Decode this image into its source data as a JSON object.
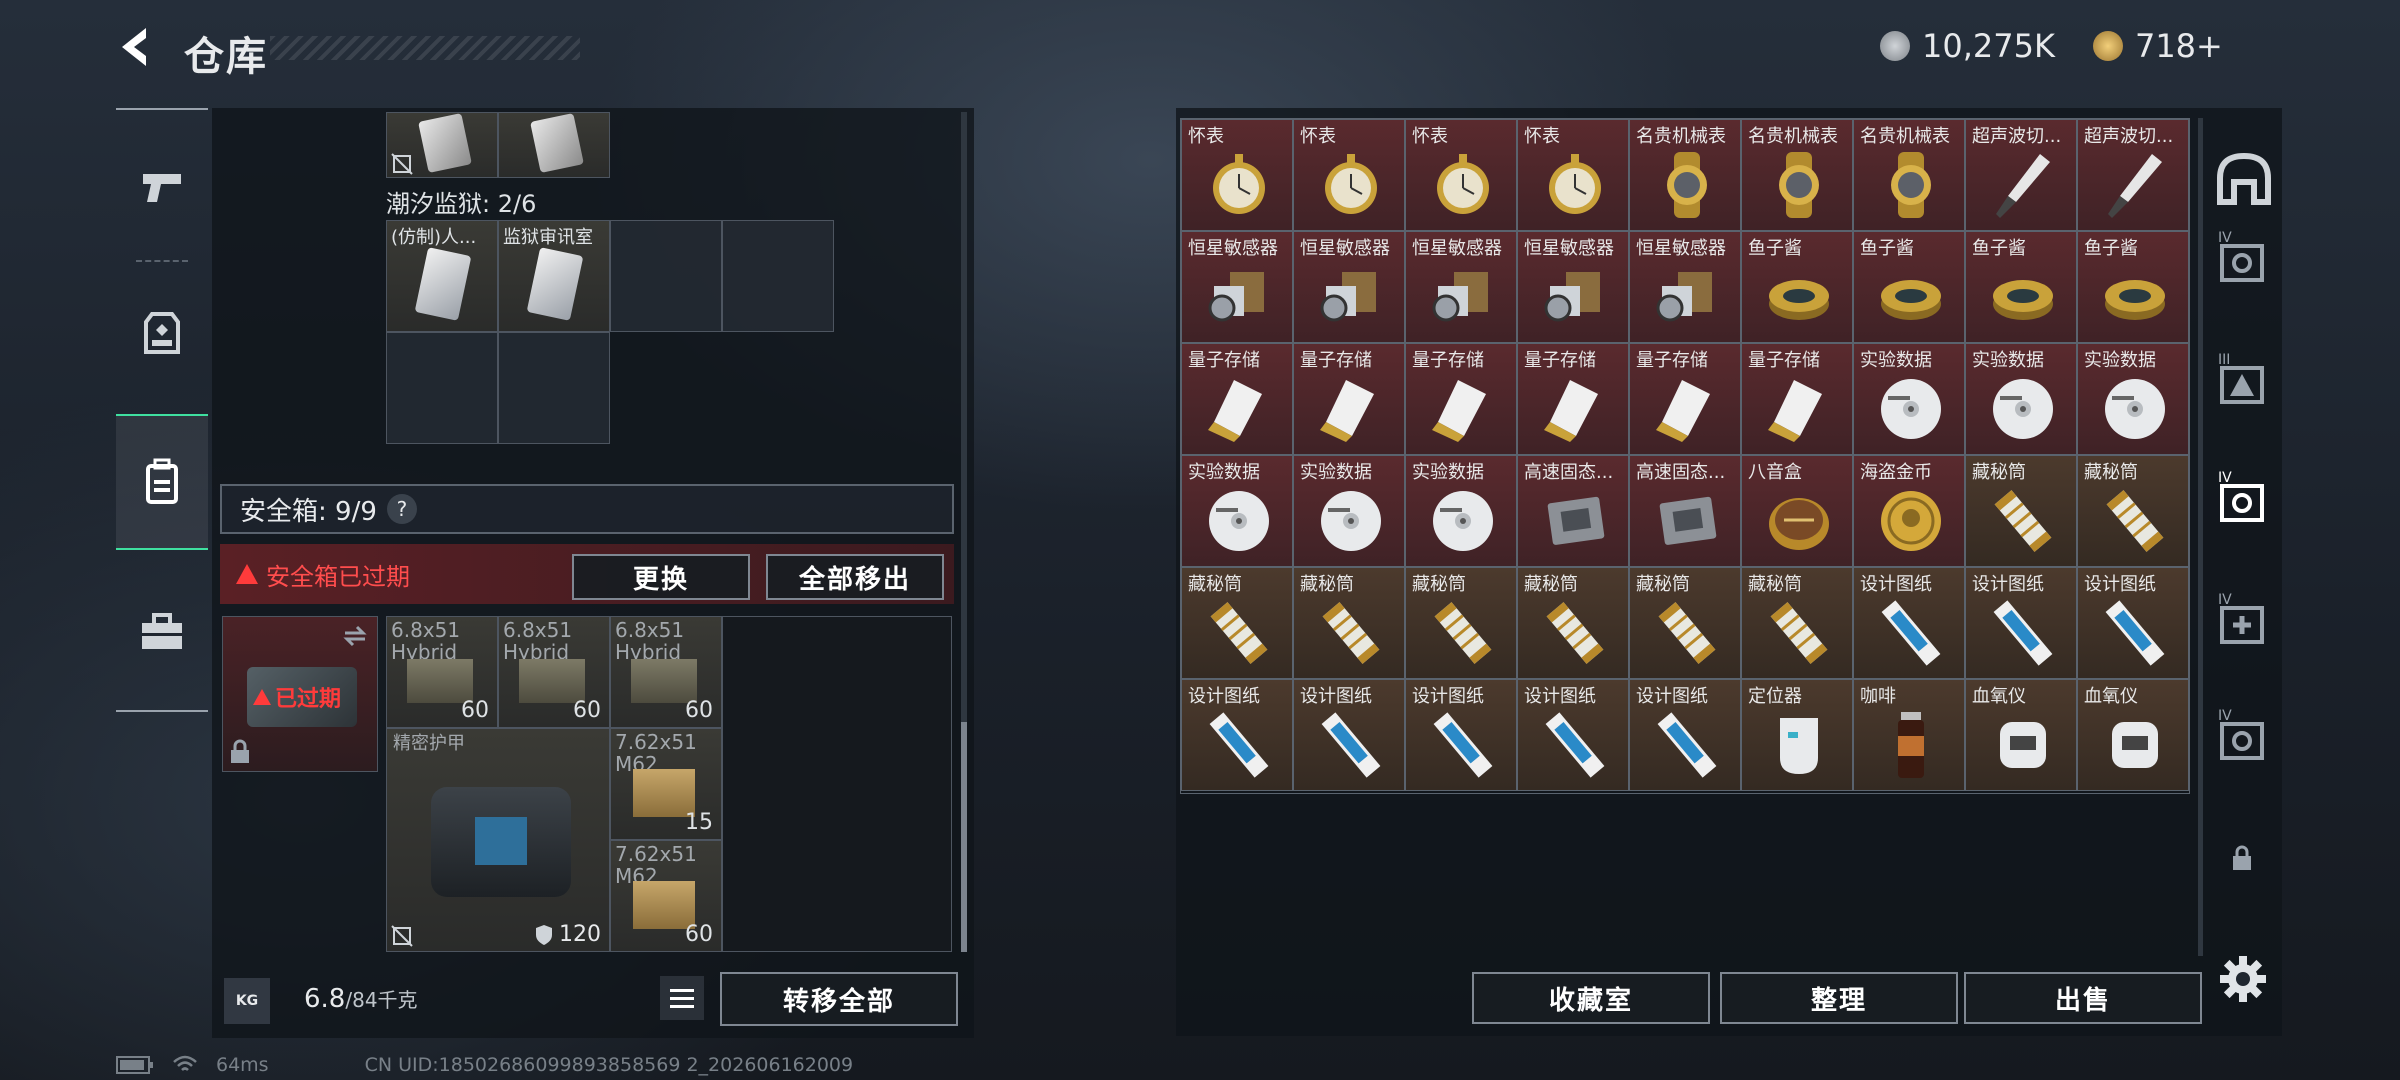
{
  "header": {
    "title": "仓库",
    "currency_silver": "10,275K",
    "currency_gold": "718+"
  },
  "left_panel": {
    "container_label": "潮汐监狱: 2/6",
    "container_items": [
      "(仿制)人...",
      "监狱审讯室"
    ],
    "safebox_label": "安全箱: 9/9",
    "safebox_help": "?",
    "expired_warning": "安全箱已过期",
    "replace_button": "更换",
    "move_all_out_button": "全部移出",
    "expired_badge": "已过期",
    "items": [
      {
        "name": "6.8x51 Hybrid",
        "qty": "60"
      },
      {
        "name": "6.8x51 Hybrid",
        "qty": "60"
      },
      {
        "name": "6.8x51 Hybrid",
        "qty": "60"
      },
      {
        "name": "精密护甲",
        "qty": "120"
      },
      {
        "name": "7.62x51 M62",
        "qty": "15"
      },
      {
        "name": "7.62x51 M62",
        "qty": "60"
      }
    ],
    "weight_current": "6.8",
    "weight_max": "/84千克",
    "kg_icon": "KG",
    "transfer_all_button": "转移全部"
  },
  "status_bar": {
    "ping": "64ms",
    "uid": "CN UID:18502686099893858569 2_202606162009"
  },
  "stash": {
    "rows": [
      [
        {
          "n": "怀表",
          "c": "red",
          "i": "watch-icon"
        },
        {
          "n": "怀表",
          "c": "red",
          "i": "watch-icon"
        },
        {
          "n": "怀表",
          "c": "red",
          "i": "watch-icon"
        },
        {
          "n": "怀表",
          "c": "red",
          "i": "watch-icon"
        },
        {
          "n": "名贵机械表",
          "c": "red",
          "i": "wristwatch-icon"
        },
        {
          "n": "名贵机械表",
          "c": "red",
          "i": "wristwatch-icon"
        },
        {
          "n": "名贵机械表",
          "c": "red",
          "i": "wristwatch-icon"
        },
        {
          "n": "超声波切...",
          "c": "red",
          "i": "knife-icon"
        },
        {
          "n": "超声波切...",
          "c": "red",
          "i": "knife-icon"
        }
      ],
      [
        {
          "n": "恒星敏感器",
          "c": "red",
          "i": "sensor-icon"
        },
        {
          "n": "恒星敏感器",
          "c": "red",
          "i": "sensor-icon"
        },
        {
          "n": "恒星敏感器",
          "c": "red",
          "i": "sensor-icon"
        },
        {
          "n": "恒星敏感器",
          "c": "red",
          "i": "sensor-icon"
        },
        {
          "n": "恒星敏感器",
          "c": "red",
          "i": "sensor-icon"
        },
        {
          "n": "鱼子酱",
          "c": "red",
          "i": "tin-icon"
        },
        {
          "n": "鱼子酱",
          "c": "red",
          "i": "tin-icon"
        },
        {
          "n": "鱼子酱",
          "c": "red",
          "i": "tin-icon"
        },
        {
          "n": "鱼子酱",
          "c": "red",
          "i": "tin-icon"
        }
      ],
      [
        {
          "n": "量子存储",
          "c": "red",
          "i": "usb-icon"
        },
        {
          "n": "量子存储",
          "c": "red",
          "i": "usb-icon"
        },
        {
          "n": "量子存储",
          "c": "red",
          "i": "usb-icon"
        },
        {
          "n": "量子存储",
          "c": "red",
          "i": "usb-icon"
        },
        {
          "n": "量子存储",
          "c": "red",
          "i": "usb-icon"
        },
        {
          "n": "量子存储",
          "c": "red",
          "i": "usb-icon"
        },
        {
          "n": "实验数据",
          "c": "red",
          "i": "disc-icon"
        },
        {
          "n": "实验数据",
          "c": "red",
          "i": "disc-icon"
        },
        {
          "n": "实验数据",
          "c": "red",
          "i": "disc-icon"
        }
      ],
      [
        {
          "n": "实验数据",
          "c": "red",
          "i": "disc-icon"
        },
        {
          "n": "实验数据",
          "c": "red",
          "i": "disc-icon"
        },
        {
          "n": "实验数据",
          "c": "red",
          "i": "disc-icon"
        },
        {
          "n": "高速固态...",
          "c": "red",
          "i": "ssd-icon"
        },
        {
          "n": "高速固态...",
          "c": "red",
          "i": "ssd-icon"
        },
        {
          "n": "八音盒",
          "c": "red",
          "i": "musicbox-icon"
        },
        {
          "n": "海盗金币",
          "c": "red",
          "i": "coin-icon"
        },
        {
          "n": "藏秘筒",
          "c": "brown",
          "i": "cylinder-icon"
        },
        {
          "n": "藏秘筒",
          "c": "brown",
          "i": "cylinder-icon"
        }
      ],
      [
        {
          "n": "藏秘筒",
          "c": "brown",
          "i": "cylinder-icon"
        },
        {
          "n": "藏秘筒",
          "c": "brown",
          "i": "cylinder-icon"
        },
        {
          "n": "藏秘筒",
          "c": "brown",
          "i": "cylinder-icon"
        },
        {
          "n": "藏秘筒",
          "c": "brown",
          "i": "cylinder-icon"
        },
        {
          "n": "藏秘筒",
          "c": "brown",
          "i": "cylinder-icon"
        },
        {
          "n": "藏秘筒",
          "c": "brown",
          "i": "cylinder-icon"
        },
        {
          "n": "设计图纸",
          "c": "brown",
          "i": "blueprint-icon"
        },
        {
          "n": "设计图纸",
          "c": "brown",
          "i": "blueprint-icon"
        },
        {
          "n": "设计图纸",
          "c": "brown",
          "i": "blueprint-icon"
        }
      ],
      [
        {
          "n": "设计图纸",
          "c": "brown",
          "i": "blueprint-icon"
        },
        {
          "n": "设计图纸",
          "c": "brown",
          "i": "blueprint-icon"
        },
        {
          "n": "设计图纸",
          "c": "brown",
          "i": "blueprint-icon"
        },
        {
          "n": "设计图纸",
          "c": "brown",
          "i": "blueprint-icon"
        },
        {
          "n": "设计图纸",
          "c": "brown",
          "i": "blueprint-icon"
        },
        {
          "n": "定位器",
          "c": "brown",
          "i": "locator-icon"
        },
        {
          "n": "咖啡",
          "c": "brown",
          "i": "coffee-icon"
        },
        {
          "n": "血氧仪",
          "c": "brown",
          "i": "oximeter-icon"
        },
        {
          "n": "血氧仪",
          "c": "brown",
          "i": "oximeter-icon"
        }
      ]
    ],
    "collection_button": "收藏室",
    "sort_button": "整理",
    "sell_button": "出售"
  },
  "right_nav": {
    "tier_labels": [
      "IV",
      "III",
      "IV",
      "IV",
      "IV"
    ]
  },
  "colors": {
    "red_cell": "#5a2a2e",
    "brown_cell": "#4c3a2d",
    "accent_green": "#3fe0a0",
    "warning_red": "#ff3b3b"
  }
}
